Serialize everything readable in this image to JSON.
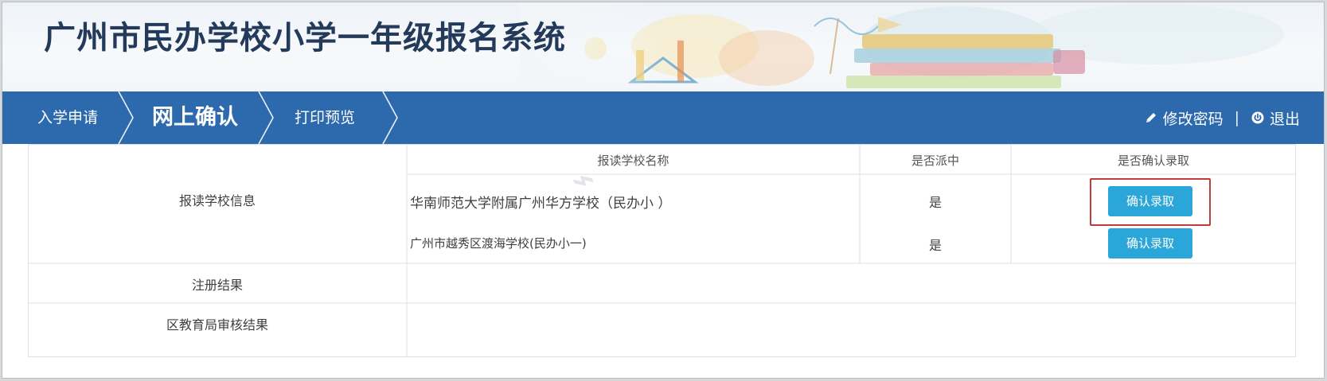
{
  "app": {
    "title": "广州市民办学校小学一年级报名系统"
  },
  "nav": {
    "steps": [
      {
        "label": "入学申请",
        "active": false
      },
      {
        "label": "网上确认",
        "active": true
      },
      {
        "label": "打印预览",
        "active": false
      }
    ],
    "right_links": {
      "change_password": "修改密码",
      "separator": "|",
      "logout": "退出"
    }
  },
  "table": {
    "rows": {
      "school_info_label": "报读学校信息",
      "registration_label": "注册结果",
      "district_review_label": "区教育局审核结果"
    },
    "headers": {
      "school_name": "报读学校名称",
      "selected": "是否派中",
      "confirm": "是否确认录取"
    },
    "schools": [
      {
        "name": "华南师范大学附属广州华方学校（民办小    ）",
        "selected": "是",
        "action": "确认录取",
        "highlighted": true
      },
      {
        "name": "广州市越秀区渡海学校(民办小一)",
        "selected": "是",
        "action": "确认录取",
        "highlighted": false
      }
    ]
  },
  "colors": {
    "nav_bg": "#2d6aad",
    "button_bg": "#2aa6d8",
    "highlight_border": "#c23a3a",
    "title_text": "#243a5a"
  },
  "icons": {
    "change_password": "pencil-icon",
    "logout": "power-icon"
  }
}
